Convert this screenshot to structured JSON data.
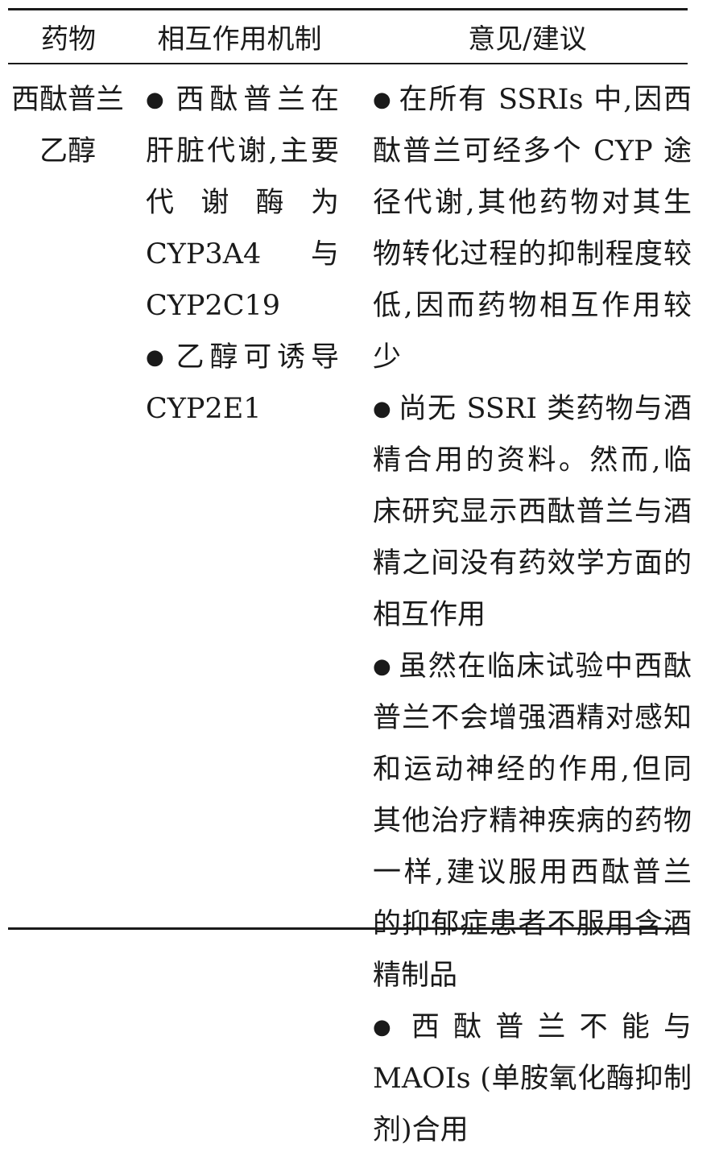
{
  "table": {
    "headers": [
      "药物",
      "相互作用机制",
      "意见/建议"
    ],
    "row": {
      "drug_lines": [
        "西酞普兰",
        "乙醇"
      ],
      "mechanism": [
        "西酞普兰在肝脏代谢,主要代谢酶为 CYP3A4 与 CYP2C19",
        "乙醇可诱导 CYP2E1"
      ],
      "advice": [
        "在所有 SSRIs 中,因西酞普兰可经多个 CYP 途径代谢,其他药物对其生物转化过程的抑制程度较低,因而药物相互作用较少",
        "尚无 SSRI 类药物与酒精合用的资料。然而,临床研究显示西酞普兰与酒精之间没有药效学方面的相互作用",
        "虽然在临床试验中西酞普兰不会增强酒精对感知和运动神经的作用,但同其他治疗精神疾病的药物一样,建议服用西酞普兰的抑郁症患者不服用含酒精制品",
        "西酞普兰不能与 MAOIs (单胺氧化酶抑制剂)合用"
      ]
    }
  },
  "bullet_symbol": "●"
}
